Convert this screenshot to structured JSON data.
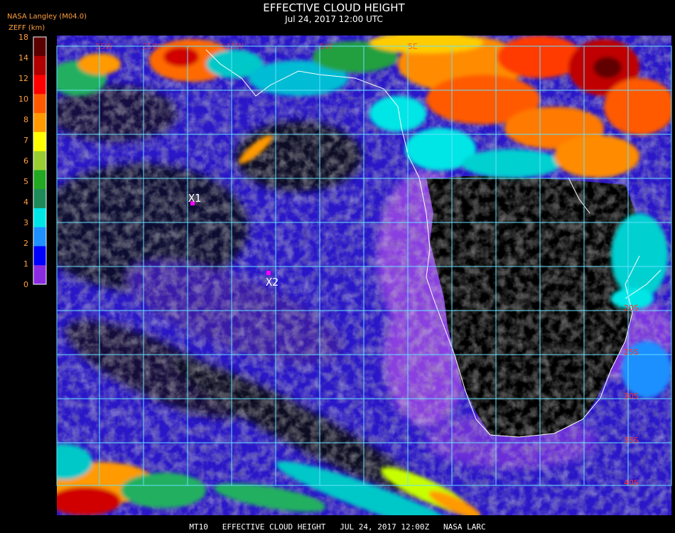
{
  "header": {
    "title": "EFFECTIVE CLOUD HEIGHT",
    "subtitle": "Jul 24, 2017 12:00 UTC",
    "source": "NASA Langley (M04.0)",
    "units": "ZEFF (km)"
  },
  "colorbar": {
    "ticks": [
      "18",
      "14",
      "12",
      "10",
      "8",
      "7",
      "6",
      "5",
      "4",
      "3",
      "2",
      "1",
      "0"
    ],
    "colors": [
      "#5a0000",
      "#b00000",
      "#ff0000",
      "#ff5a00",
      "#ff9a00",
      "#ffff00",
      "#9acd32",
      "#22a822",
      "#1e8a5a",
      "#00e6e6",
      "#1e90ff",
      "#0000ff",
      "#8a2be2"
    ]
  },
  "markers": [
    {
      "label": "X1",
      "color": "#ff00ff"
    },
    {
      "label": "X2",
      "color": "#ff00ff"
    }
  ],
  "lat_labels": [
    "20S",
    "25S",
    "30S",
    "35S",
    "40S"
  ],
  "lon_labels": [
    "35W",
    "25W",
    "15W",
    "5W",
    "5E",
    "15E"
  ],
  "footer": "MT10   EFFECTIVE CLOUD HEIGHT   JUL 24, 2017 12:00Z   NASA LARC",
  "colors": {
    "grid": "#66e0ff",
    "coast": "#ffffff",
    "lat_label": "#ff3030",
    "header_text": "#ffffff",
    "source_text": "#ffa040"
  }
}
